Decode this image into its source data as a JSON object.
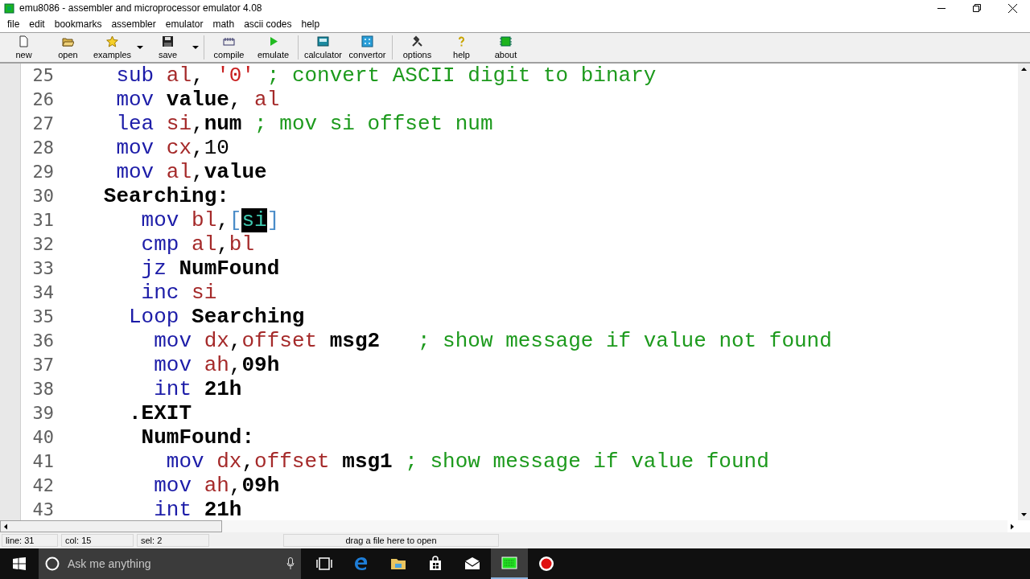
{
  "window": {
    "title": "emu8086 - assembler and microprocessor emulator 4.08"
  },
  "menu": [
    "file",
    "edit",
    "bookmarks",
    "assembler",
    "emulator",
    "math",
    "ascii codes",
    "help"
  ],
  "toolbar": [
    {
      "label": "new",
      "kind": "new"
    },
    {
      "label": "open",
      "kind": "open"
    },
    {
      "label": "examples",
      "kind": "examples"
    },
    {
      "kind": "dropdown"
    },
    {
      "label": "save",
      "kind": "save"
    },
    {
      "kind": "dropdown"
    },
    {
      "kind": "separator"
    },
    {
      "label": "compile",
      "kind": "compile"
    },
    {
      "label": "emulate",
      "kind": "emulate"
    },
    {
      "kind": "separator"
    },
    {
      "label": "calculator",
      "kind": "calculator"
    },
    {
      "label": "convertor",
      "kind": "convertor"
    },
    {
      "kind": "separator"
    },
    {
      "label": "options",
      "kind": "options"
    },
    {
      "label": "help",
      "kind": "help"
    },
    {
      "label": "about",
      "kind": "about"
    }
  ],
  "editor": {
    "lines": [
      {
        "number": "25",
        "tokens": [
          {
            "text": "    sub ",
            "kind": "keyword"
          },
          {
            "text": "al",
            "kind": "register"
          },
          {
            "text": ", ",
            "kind": "plain"
          },
          {
            "text": "'0'",
            "kind": "string"
          },
          {
            "text": " ; convert ASCII digit to binary",
            "kind": "comment"
          }
        ]
      },
      {
        "number": "26",
        "tokens": [
          {
            "text": "    mov ",
            "kind": "keyword"
          },
          {
            "text": "value",
            "kind": "name"
          },
          {
            "text": ", ",
            "kind": "plain"
          },
          {
            "text": "al",
            "kind": "register"
          }
        ]
      },
      {
        "number": "27",
        "tokens": [
          {
            "text": "    lea ",
            "kind": "keyword"
          },
          {
            "text": "si",
            "kind": "register"
          },
          {
            "text": ",",
            "kind": "plain"
          },
          {
            "text": "num",
            "kind": "name"
          },
          {
            "text": " ; mov si offset num",
            "kind": "comment"
          }
        ]
      },
      {
        "number": "28",
        "tokens": [
          {
            "text": "    mov ",
            "kind": "keyword"
          },
          {
            "text": "cx",
            "kind": "register"
          },
          {
            "text": ",10",
            "kind": "plain"
          }
        ]
      },
      {
        "number": "29",
        "tokens": [
          {
            "text": "    mov ",
            "kind": "keyword"
          },
          {
            "text": "al",
            "kind": "register"
          },
          {
            "text": ",",
            "kind": "plain"
          },
          {
            "text": "value",
            "kind": "name"
          }
        ]
      },
      {
        "number": "30",
        "tokens": [
          {
            "text": "   Searching:",
            "kind": "name"
          }
        ]
      },
      {
        "number": "31",
        "tokens": [
          {
            "text": "      mov ",
            "kind": "keyword"
          },
          {
            "text": "bl",
            "kind": "register"
          },
          {
            "text": ",",
            "kind": "plain"
          },
          {
            "text": "[",
            "kind": "bracket"
          },
          {
            "text": "si",
            "kind": "selection"
          },
          {
            "text": "]",
            "kind": "bracket"
          }
        ]
      },
      {
        "number": "32",
        "tokens": [
          {
            "text": "      cmp ",
            "kind": "keyword"
          },
          {
            "text": "al",
            "kind": "register"
          },
          {
            "text": ",",
            "kind": "plain"
          },
          {
            "text": "bl",
            "kind": "register"
          }
        ]
      },
      {
        "number": "33",
        "tokens": [
          {
            "text": "      jz ",
            "kind": "keyword"
          },
          {
            "text": "NumFound",
            "kind": "name"
          }
        ]
      },
      {
        "number": "34",
        "tokens": [
          {
            "text": "      inc ",
            "kind": "keyword"
          },
          {
            "text": "si",
            "kind": "register"
          }
        ]
      },
      {
        "number": "35",
        "tokens": [
          {
            "text": "     Loop ",
            "kind": "keyword"
          },
          {
            "text": "Searching",
            "kind": "name"
          }
        ]
      },
      {
        "number": "36",
        "tokens": [
          {
            "text": "       mov ",
            "kind": "keyword"
          },
          {
            "text": "dx",
            "kind": "register"
          },
          {
            "text": ",",
            "kind": "plain"
          },
          {
            "text": "offset ",
            "kind": "register"
          },
          {
            "text": "msg2",
            "kind": "name"
          },
          {
            "text": "   ; show message if value not found",
            "kind": "comment"
          }
        ]
      },
      {
        "number": "37",
        "tokens": [
          {
            "text": "       mov ",
            "kind": "keyword"
          },
          {
            "text": "ah",
            "kind": "register"
          },
          {
            "text": ",",
            "kind": "plain"
          },
          {
            "text": "09h",
            "kind": "name"
          }
        ]
      },
      {
        "number": "38",
        "tokens": [
          {
            "text": "       int ",
            "kind": "keyword"
          },
          {
            "text": "21h",
            "kind": "name"
          }
        ]
      },
      {
        "number": "39",
        "tokens": [
          {
            "text": "     .EXIT",
            "kind": "name"
          }
        ]
      },
      {
        "number": "40",
        "tokens": [
          {
            "text": "      NumFound:",
            "kind": "name"
          }
        ]
      },
      {
        "number": "41",
        "tokens": [
          {
            "text": "        mov ",
            "kind": "keyword"
          },
          {
            "text": "dx",
            "kind": "register"
          },
          {
            "text": ",",
            "kind": "plain"
          },
          {
            "text": "offset ",
            "kind": "register"
          },
          {
            "text": "msg1",
            "kind": "name"
          },
          {
            "text": " ; show message if value found",
            "kind": "comment"
          }
        ]
      },
      {
        "number": "42",
        "tokens": [
          {
            "text": "       mov ",
            "kind": "keyword"
          },
          {
            "text": "ah",
            "kind": "register"
          },
          {
            "text": ",",
            "kind": "plain"
          },
          {
            "text": "09h",
            "kind": "name"
          }
        ]
      },
      {
        "number": "43",
        "tokens": [
          {
            "text": "       int ",
            "kind": "keyword"
          },
          {
            "text": "21h",
            "kind": "name"
          }
        ]
      }
    ]
  },
  "status_bar": {
    "line": "line: 31",
    "col": "col: 15",
    "sel": "sel: 2",
    "hint": "drag a file here to open"
  },
  "taskbar": {
    "search_placeholder": "Ask me anything",
    "apps": [
      {
        "kind": "task-view",
        "active": false
      },
      {
        "kind": "browser",
        "active": false
      },
      {
        "kind": "folder",
        "active": false
      },
      {
        "kind": "store",
        "active": false
      },
      {
        "kind": "mail",
        "active": false
      },
      {
        "kind": "chip",
        "active": true
      },
      {
        "kind": "record",
        "active": false
      }
    ]
  }
}
